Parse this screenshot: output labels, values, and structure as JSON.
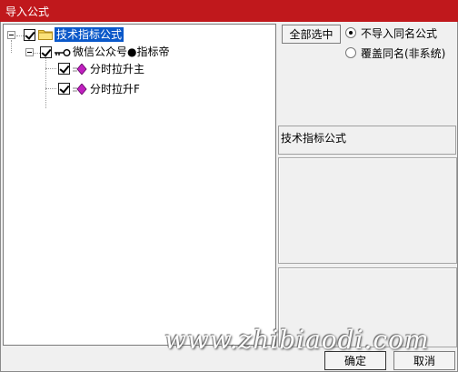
{
  "window": {
    "title": "导入公式"
  },
  "tree": {
    "root": {
      "label": "技术指标公式",
      "checked": true,
      "expanded": true
    },
    "group": {
      "label": "微信公众号●指标帝",
      "checked": true,
      "expanded": true
    },
    "items": [
      {
        "label": "分时拉升主",
        "checked": true
      },
      {
        "label": "分时拉升F",
        "checked": true
      }
    ]
  },
  "options": {
    "select_all_label": "全部选中",
    "radio_skip_label": "不导入同名公式",
    "radio_overwrite_label": "覆盖同名(非系统)",
    "selected": "不导入同名公式"
  },
  "detail": {
    "title": "技术指标公式"
  },
  "buttons": {
    "ok": "确定",
    "cancel": "取消"
  },
  "watermark": "www.zhibiaodi.com",
  "colors": {
    "titlebar": "#c0181c",
    "selection": "#0a58c9",
    "diamond": "#c020c0"
  }
}
